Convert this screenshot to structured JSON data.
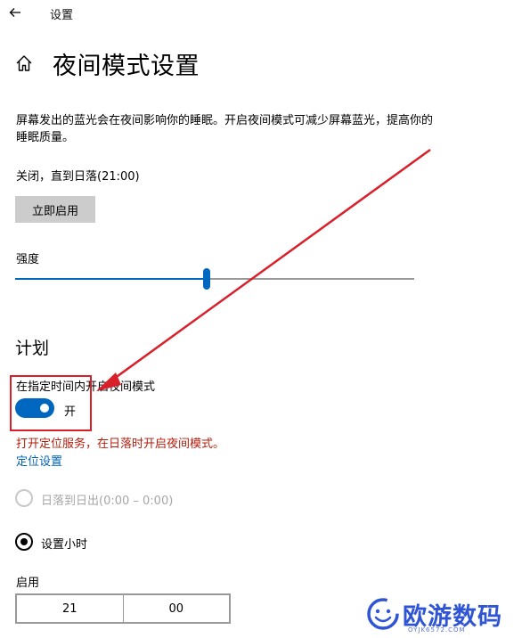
{
  "header": {
    "back_icon": "arrow-left-icon",
    "title": "设置"
  },
  "page": {
    "home_icon": "home-icon",
    "title": "夜间模式设置",
    "description": "屏幕发出的蓝光会在夜间影响你的睡眠。开启夜间模式可减少屏幕蓝光，提高你的睡眠质量。",
    "status": "关闭，直到日落(21:00)",
    "enable_now_label": "立即启用",
    "strength_label": "强度",
    "strength_value": 0.48
  },
  "schedule": {
    "section_title": "计划",
    "toggle_label": "在指定时间内开启夜间模式",
    "toggle_state_text": "开",
    "toggle_on": true,
    "warning_text": "打开定位服务，在日落时开启夜间模式。",
    "location_link": "定位设置",
    "options": [
      {
        "label": "日落到日出(0:00 – 0:00)",
        "selected": false,
        "disabled": true
      },
      {
        "label": "设置小时",
        "selected": true,
        "disabled": false
      }
    ],
    "enable_label": "启用",
    "time": {
      "hour": "21",
      "minute": "00"
    }
  },
  "annotation": {
    "color": "#d9202a"
  },
  "watermark": {
    "logo_icon": "smiley-logo-icon",
    "text": "欧游数码",
    "sub": "OYJK6572.COM"
  },
  "colors": {
    "accent": "#0067c0",
    "warning": "#b31d0b",
    "link": "#0063b1"
  }
}
